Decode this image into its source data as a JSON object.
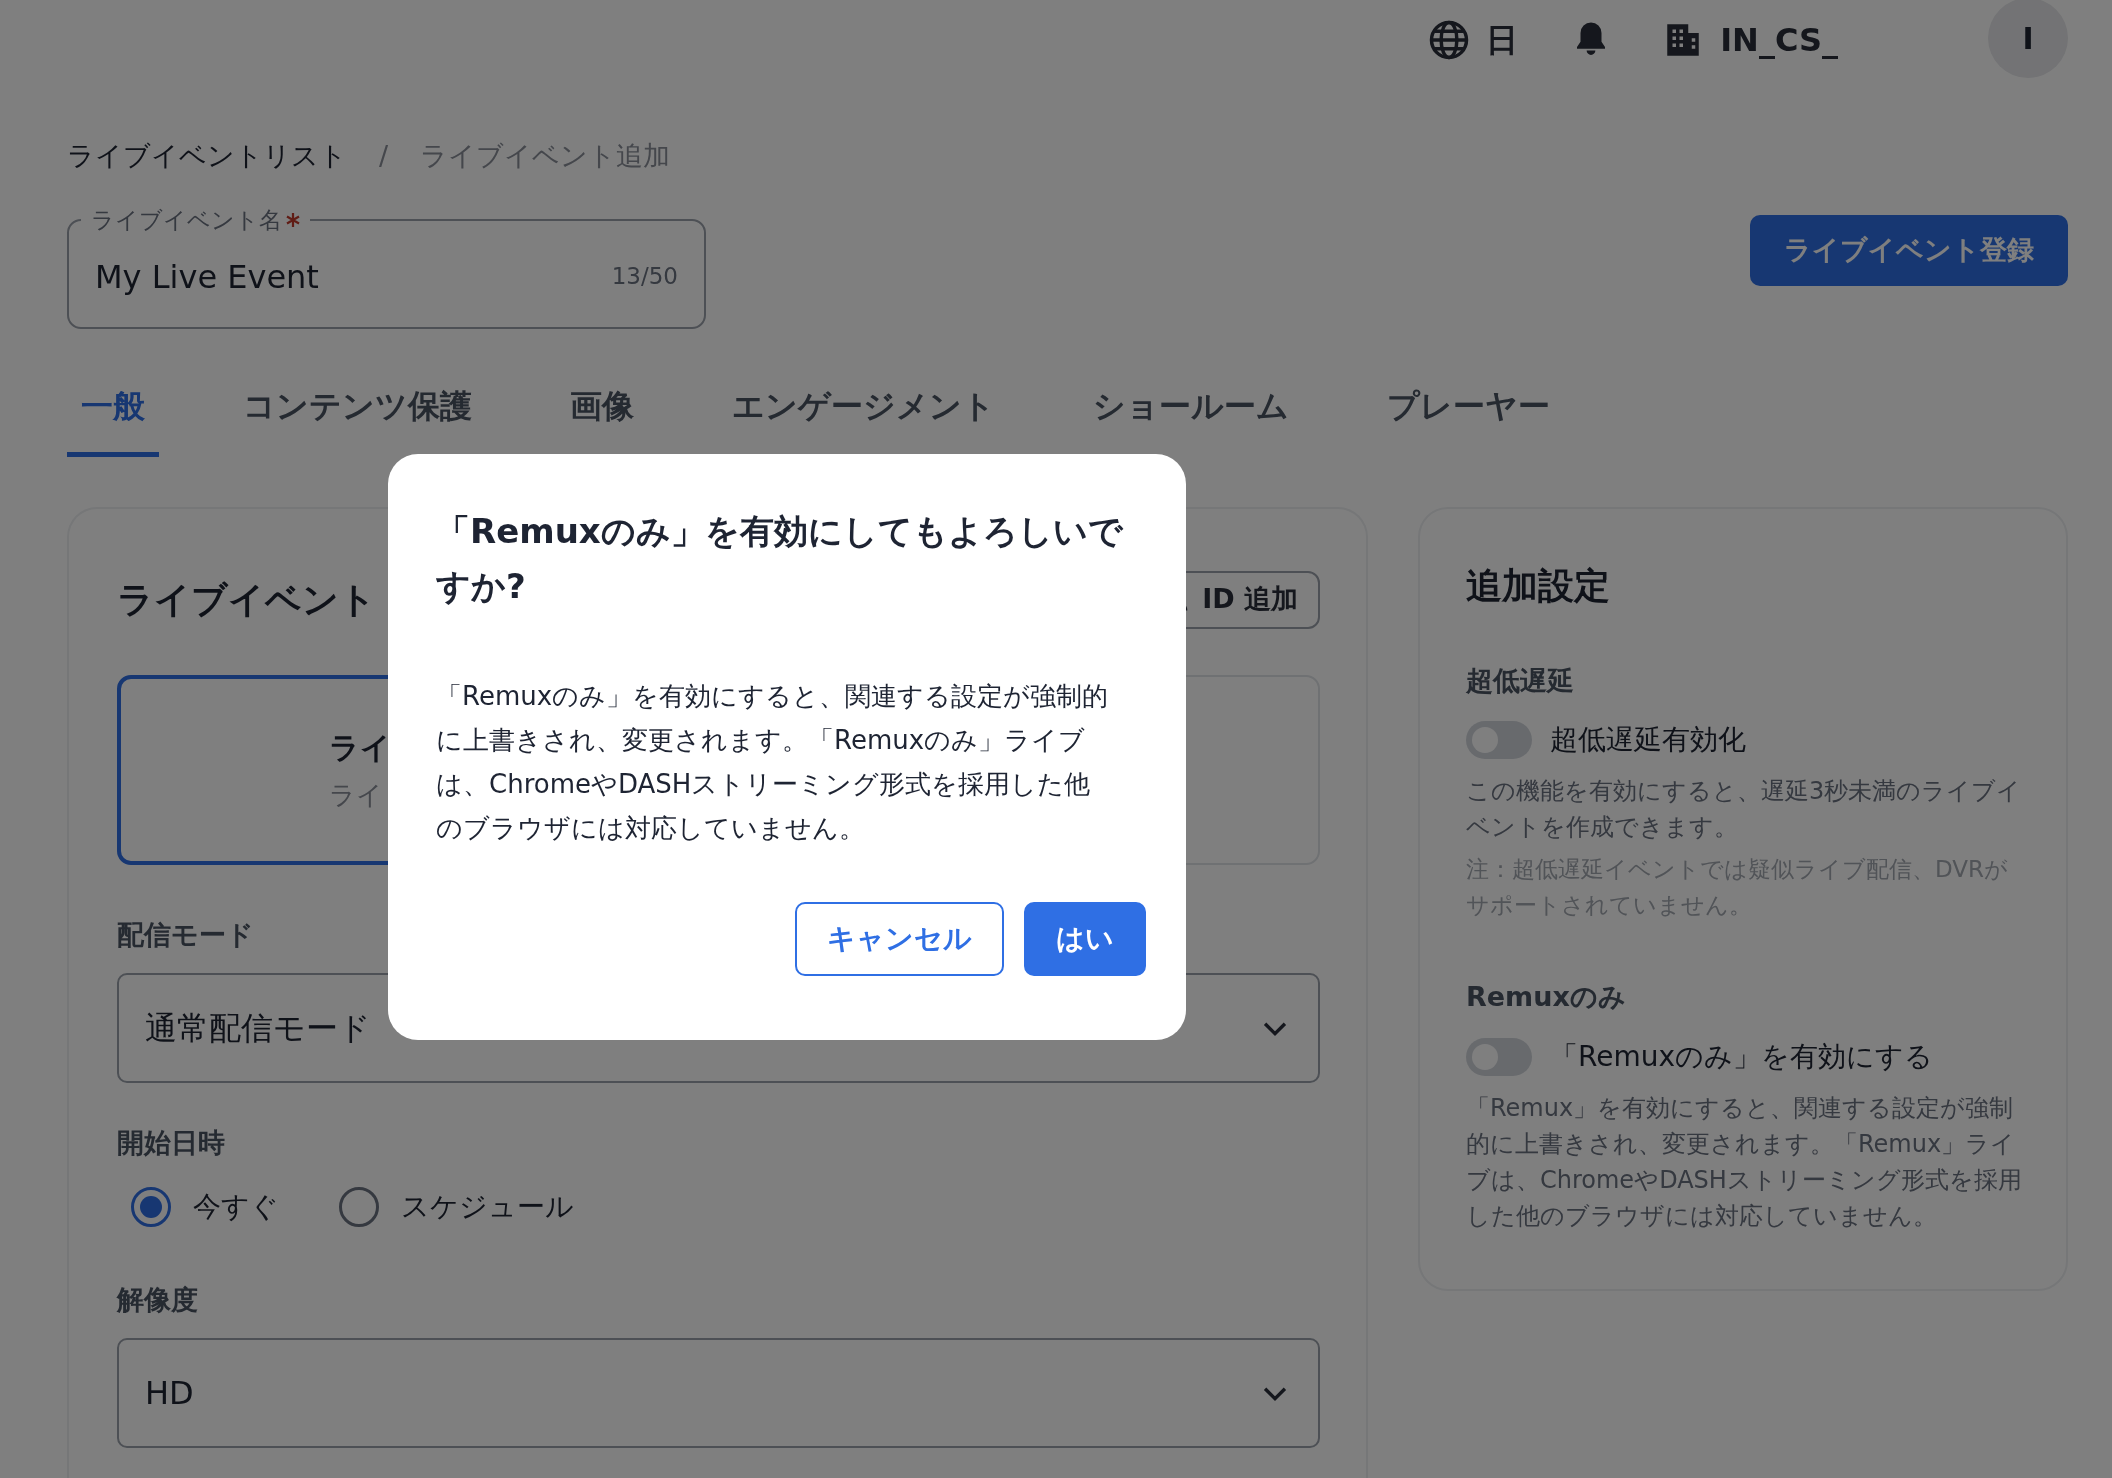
{
  "top_bar": {
    "language": "日",
    "account": "IN_CS_",
    "avatar": "I"
  },
  "breadcrumb": [
    {
      "label": "ライブイベントリスト",
      "current": false
    },
    {
      "label": "ライブイベント追加",
      "current": true
    }
  ],
  "breadcrumb_separator": "/",
  "name_field": {
    "label": "ライブイベント名",
    "required": true,
    "value": "My Live Event",
    "counter": "13/50"
  },
  "register_button": "ライブイベント登録",
  "tabs": [
    {
      "label": "一般",
      "selected": true
    },
    {
      "label": "コンテンツ保護",
      "selected": false
    },
    {
      "label": "画像",
      "selected": false
    },
    {
      "label": "エンゲージメント",
      "selected": false
    },
    {
      "label": "ショールーム",
      "selected": false
    },
    {
      "label": "プレーヤー",
      "selected": false
    }
  ],
  "settings_card": {
    "title": "ライブイベント",
    "id_button": "ID 追加",
    "type_options": [
      {
        "title": "ライ",
        "subtitle": "ライ",
        "selected": true
      },
      {
        "selected": false
      }
    ],
    "delivery_mode": {
      "label": "配信モード",
      "value": "通常配信モード"
    },
    "start": {
      "label": "開始日時",
      "options": [
        {
          "label": "今すぐ",
          "selected": true
        },
        {
          "label": "スケジュール",
          "selected": false
        }
      ]
    },
    "resolution": {
      "label": "解像度",
      "value": "HD"
    }
  },
  "additional_settings": {
    "title": "追加設定",
    "sections": [
      {
        "heading": "超低遅延",
        "toggle_label": "超低遅延有効化",
        "on": false,
        "description": "この機能を有効にすると、遅延3秒未満のライブイベントを作成できます。",
        "note": "注：超低遅延イベントでは疑似ライブ配信、DVRがサポートされていません。"
      },
      {
        "heading": "Remuxのみ",
        "toggle_label": "「Remuxのみ」を有効にする",
        "on": false,
        "description": "「Remux」を有効にすると、関連する設定が強制的に上書きされ、変更されます。「Remux」ライブは、ChromeやDASHストリーミング形式を採用した他のブラウザには対応していません。"
      }
    ]
  },
  "dialog": {
    "title": "「Remuxのみ」を有効にしてもよろしいですか?",
    "message": "「Remuxのみ」を有効にすると、関連する設定が強制的に上書きされ、変更されます。「Remuxのみ」ライブは、ChromeやDASHストリーミング形式を採用した他のブラウザには対応していません。",
    "buttons": [
      {
        "label": "キャンセル",
        "kind": "secondary"
      },
      {
        "label": "はい",
        "kind": "primary"
      }
    ]
  }
}
